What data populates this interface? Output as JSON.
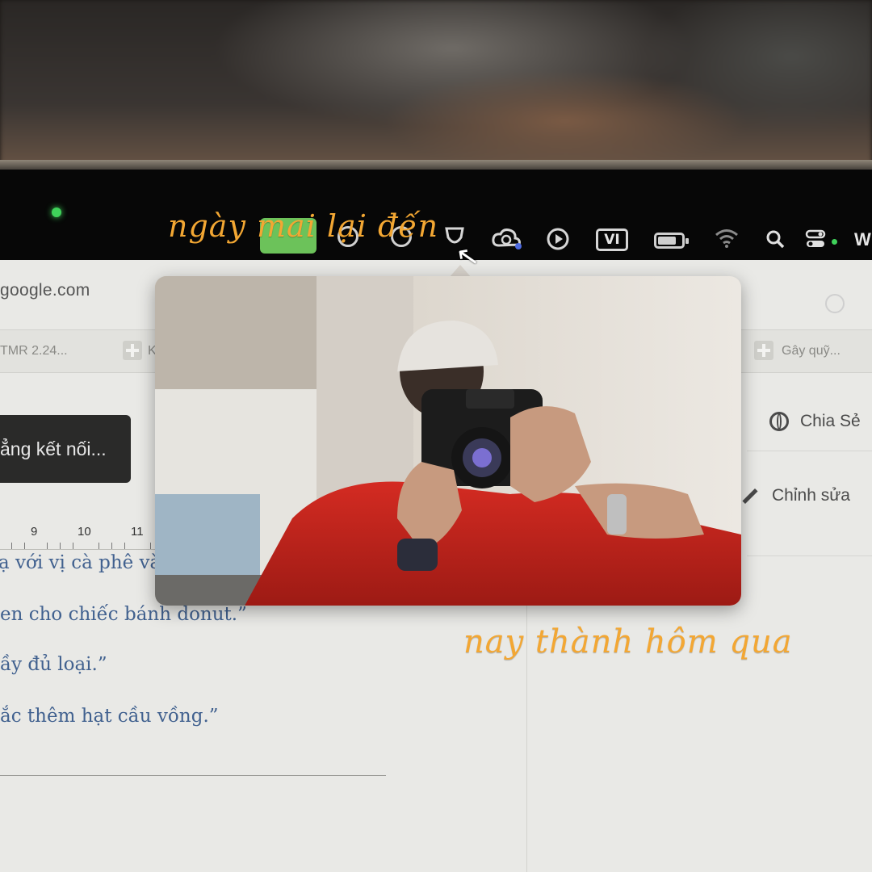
{
  "menubar": {
    "input_source": "VI",
    "battery_level": 0.8,
    "user_initial": "W",
    "icons": [
      "green-app-icon",
      "screen-record-icon",
      "circle-icon",
      "shield-icon",
      "cloud-sync-icon",
      "play-icon",
      "battery-icon",
      "wifi-icon",
      "search-icon",
      "control-center-icon"
    ]
  },
  "browser": {
    "url": "google.com",
    "tabs": [
      {
        "label": "TMR 2.24..."
      },
      {
        "label": "K"
      },
      {
        "label": "Gây quỹ..."
      }
    ],
    "connect_button": "ẳng kết nối...",
    "ruler_ticks": [
      "9",
      "10",
      "11"
    ],
    "doc_lines": [
      "ạ với vị cà phê và",
      "en cho chiếc bánh donut.”",
      "ầy đủ loại.”",
      "ắc thêm hạt cầu vồng.”"
    ],
    "side_panel": {
      "share_label": "Chia Sẻ",
      "edit_label": "Chỉnh sửa"
    }
  },
  "overlay_text": {
    "line1": "ngày mai lại đến",
    "line2": "nay thành hôm qua"
  },
  "colors": {
    "accent_script": "#f3a733",
    "camera_dot": "#3fd25a",
    "shirt": "#c8231e",
    "doc_text": "#41618f"
  }
}
